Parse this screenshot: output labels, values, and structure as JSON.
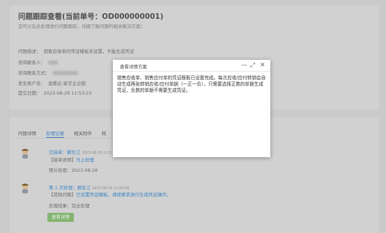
{
  "page": {
    "title": "问题跟踪查看(当前单号：OD000000001)",
    "subtitle": "您可以在此处理进行问题跟踪，详细了解问题的相关解决方案！",
    "fields": [
      {
        "key": "问题描述：",
        "value": "销售应收单的凭证模板未设置，不能生成凭证"
      },
      {
        "key": "咨询联系人：",
        "value": ""
      },
      {
        "key": "咨询联系方式：",
        "value": ""
      },
      {
        "key": "发生账户名：",
        "value": "金蝶云·星空企业版"
      },
      {
        "key": "提交日期：",
        "value": "2023-08-28 11:53:23"
      }
    ]
  },
  "tabs": [
    "问题详情",
    "处理记录",
    "相关附件",
    "耗"
  ],
  "timeline": [
    {
      "status": "已接单：",
      "person": "赖生江",
      "time": "2023-08-28 11:5",
      "note_label": "【接单说明】",
      "note": "马上处理",
      "expect": "预计处理：2023-08-28"
    },
    {
      "status": "第 1 次处理：",
      "person": "赖生江",
      "time": "2023-08-28 11:56:08",
      "note_label": "【其他问题】",
      "note": "已设置凭证模板，请按要求进行生成凭证操作。",
      "result": "处理结果：完全处理"
    }
  ],
  "detail_button": "查看详情",
  "modal": {
    "title": "查看详情方案",
    "minimize": "—",
    "maximize": "⤢",
    "close": "✕",
    "body": "销售应收单、销售应付单的凭证模板已设置完成。每次应收/应付转销会自动生成两张转销应收/应付单据（一正一负），只需要选择正数的单据生成凭证，负数的单据不需要生成凭证。"
  },
  "colors": {
    "accent": "#3f8fd6",
    "button_green": "#8fc57a"
  }
}
